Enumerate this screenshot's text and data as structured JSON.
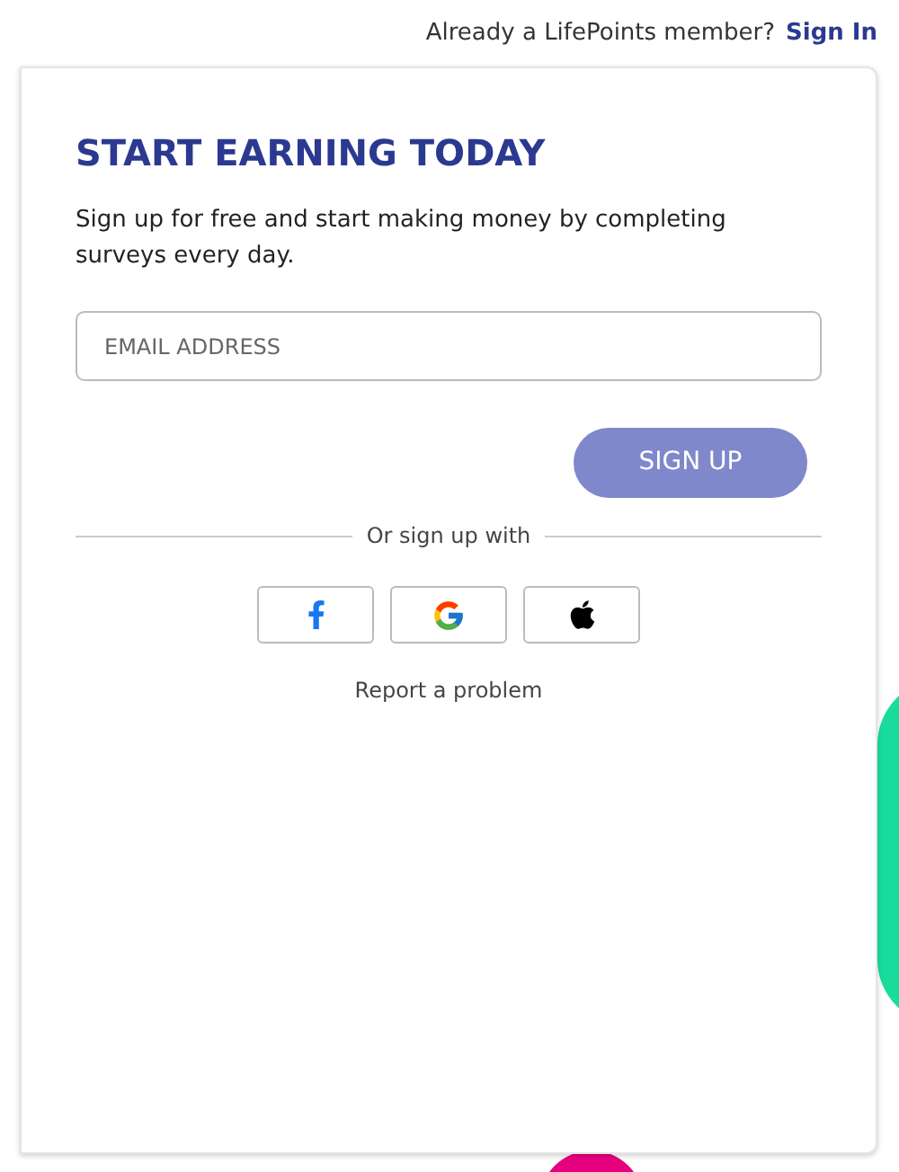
{
  "header": {
    "prompt": "Already a LifePoints member?",
    "link": "Sign In"
  },
  "card": {
    "title": "START EARNING TODAY",
    "description": "Sign up for free and start making money by completing surveys every day.",
    "email": {
      "placeholder": "EMAIL ADDRESS"
    },
    "submit": {
      "label": "SIGN UP",
      "disabled": true
    },
    "divider": "Or sign up with",
    "social": [
      {
        "kind": "facebook"
      },
      {
        "kind": "google"
      },
      {
        "kind": "apple"
      }
    ],
    "report": "Report a problem"
  }
}
